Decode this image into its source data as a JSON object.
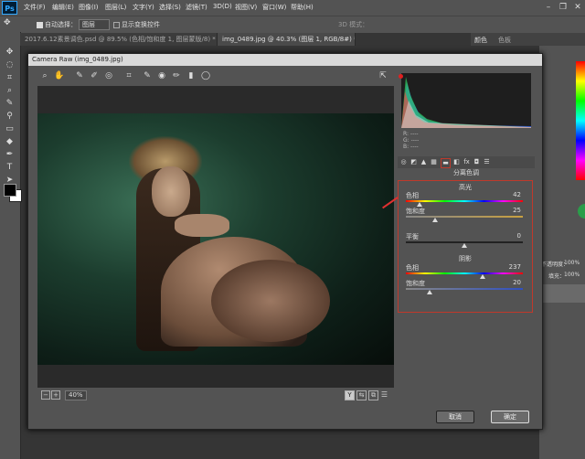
{
  "app": {
    "logo": "Ps",
    "menus": [
      "文件(F)",
      "编辑(E)",
      "图像(I)",
      "图层(L)",
      "文字(Y)",
      "选择(S)",
      "滤镜(T)",
      "3D(D)",
      "视图(V)",
      "窗口(W)",
      "帮助(H)"
    ]
  },
  "options": {
    "auto_select_label": "自动选择：",
    "auto_select_value": "图层",
    "show_transform_label": "显示变换控件",
    "mode_3d": "3D 模式："
  },
  "tabs": [
    {
      "label": "2017.6.12素景调色.psd @ 89.5% (色相/饱和度 1, 图层蒙版/8) *"
    },
    {
      "label": "img_0489.jpg @ 40.3% (图层 1, RGB/8#) *"
    }
  ],
  "right_panel": {
    "tabs": [
      "颜色",
      "色板"
    ],
    "opacity_label": "不透明度：",
    "opacity_value": "100%",
    "fill_label": "填充：",
    "fill_value": "100%"
  },
  "camera_raw": {
    "title": "Camera Raw (img_0489.jpg)",
    "zoom": "40%",
    "rgb": {
      "r": "R:  ----",
      "g": "G:  ----",
      "b": "B:  ----"
    },
    "panel_title": "分离色调",
    "highlights": {
      "header": "高光",
      "hue_label": "色相",
      "hue_value": 42,
      "sat_label": "饱和度",
      "sat_value": 25
    },
    "balance": {
      "label": "平衡",
      "value": 0
    },
    "shadows": {
      "header": "阴影",
      "hue_label": "色相",
      "hue_value": 237,
      "sat_label": "饱和度",
      "sat_value": 20
    },
    "cancel": "取消",
    "ok": "确定"
  },
  "colors": {
    "accent_red": "#c0392b",
    "dialog_bg": "#535353"
  }
}
